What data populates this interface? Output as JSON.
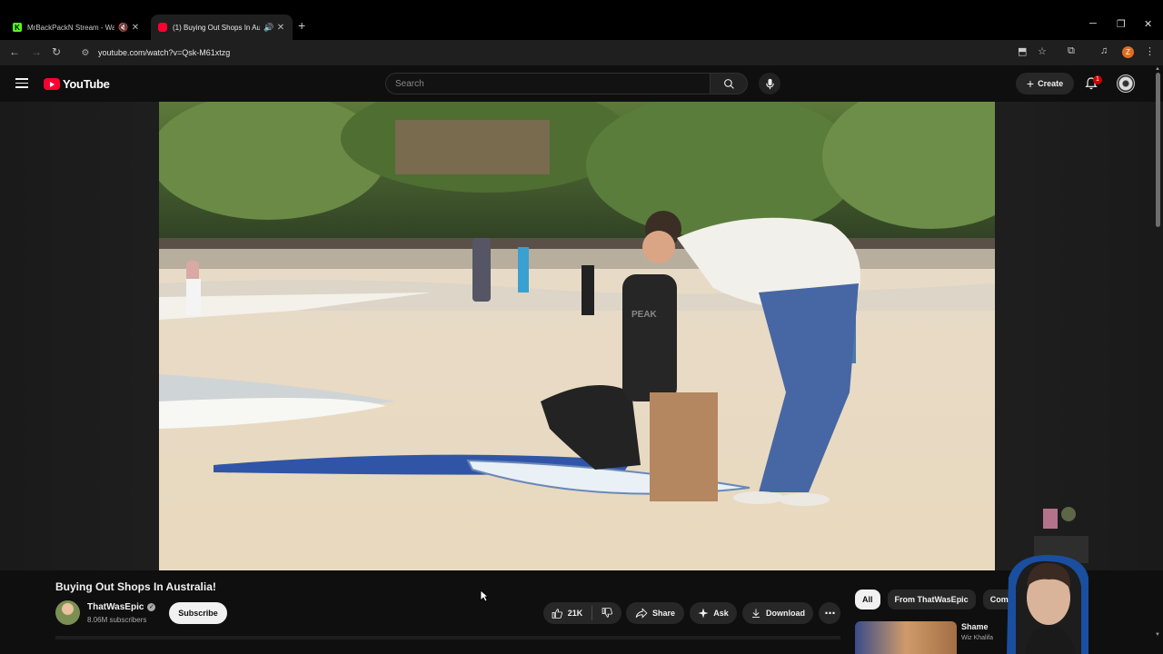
{
  "browser": {
    "tabs": [
      {
        "title": "MrBackPackN Stream - Wat",
        "favicon": "kick-icon",
        "muted": true,
        "active": false
      },
      {
        "title": "(1) Buying Out Shops In Aus",
        "favicon": "youtube-icon",
        "muted": false,
        "active": true
      }
    ],
    "url": "youtube.com/watch?v=Qsk-M61xtzg",
    "profile_initial": "Z"
  },
  "youtube": {
    "logo_text": "YouTube",
    "search_placeholder": "Search",
    "create_label": "Create",
    "notification_count": "1"
  },
  "video": {
    "title": "Buying Out Shops In Australia!",
    "channel": "ThatWasEpic",
    "subscribers": "8.06M subscribers",
    "subscribe_label": "Subscribe",
    "likes": "21K",
    "share_label": "Share",
    "ask_label": "Ask",
    "download_label": "Download",
    "wetsuit_text": "PEAK"
  },
  "sidebar": {
    "chips": [
      "All",
      "From ThatWasEpic",
      "Comedy"
    ],
    "recommended": {
      "title": "Shame",
      "channel": "Wiz Khalifa"
    }
  },
  "colors": {
    "brand_red": "#ff0033",
    "background": "#0f0f0f",
    "pill": "#272727"
  }
}
